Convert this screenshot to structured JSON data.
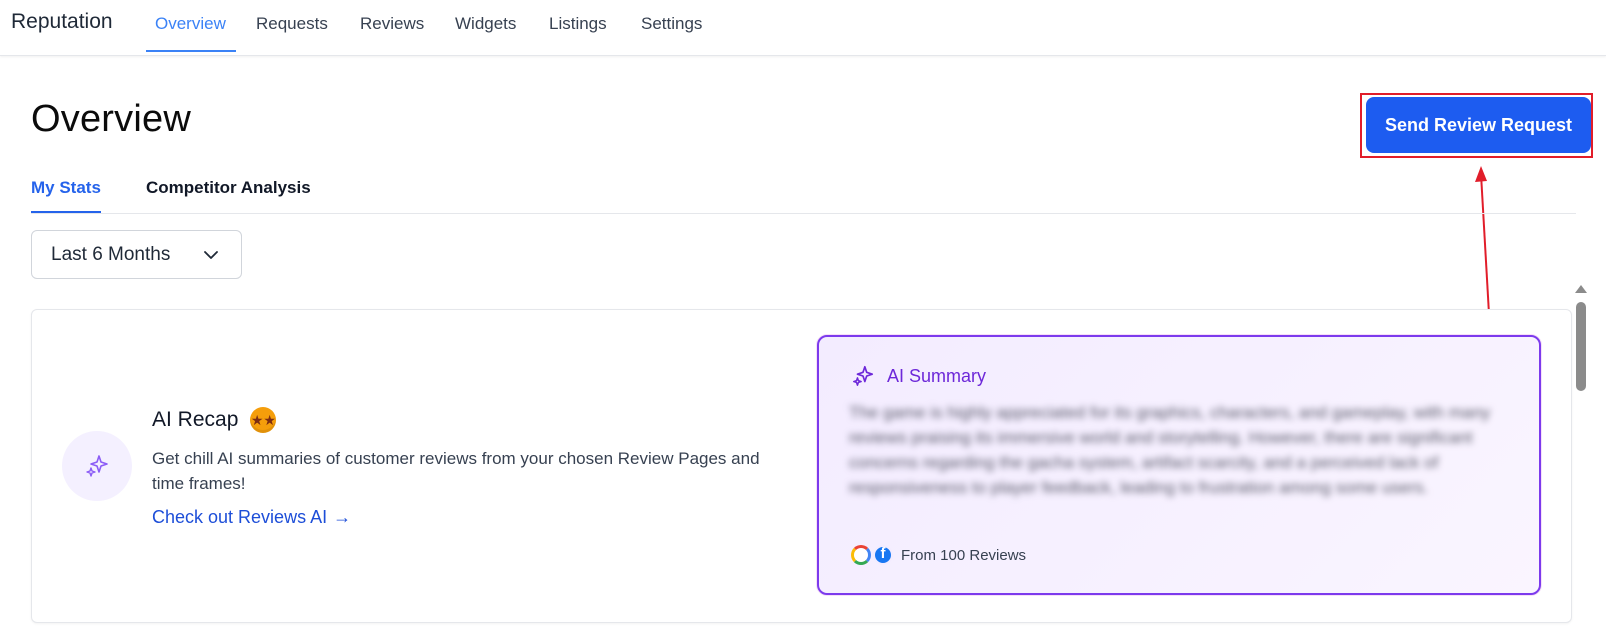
{
  "app": {
    "brand": "Reputation",
    "nav": [
      {
        "label": "Overview",
        "active": true
      },
      {
        "label": "Requests"
      },
      {
        "label": "Reviews"
      },
      {
        "label": "Widgets"
      },
      {
        "label": "Listings"
      },
      {
        "label": "Settings"
      }
    ]
  },
  "page": {
    "title": "Overview",
    "cta_label": "Send Review Request"
  },
  "subtabs": [
    {
      "label": "My Stats",
      "active": true
    },
    {
      "label": "Competitor Analysis"
    }
  ],
  "filter": {
    "selected": "Last 6 Months"
  },
  "recap": {
    "title": "AI Recap",
    "emoji_icon": "star-struck-emoji-icon",
    "description": "Get chill AI summaries of customer reviews from your chosen Review Pages and time frames!",
    "link_label": "Check out Reviews AI",
    "link_arrow": "→"
  },
  "summary": {
    "title": "AI Summary",
    "text": "The game is highly appreciated for its graphics, characters, and gameplay, with many reviews praising its immersive world and storytelling. However, there are significant concerns regarding the gacha system, artifact scarcity, and a perceived lack of responsiveness to player feedback, leading to frustration among some users.",
    "source_label": "From 100 Reviews",
    "sources": [
      "google-logo-icon",
      "facebook-logo-icon"
    ]
  },
  "colors": {
    "accent": "#1d5cf0",
    "nav_active": "#3b82f6",
    "highlight": "#e11d2a",
    "ai_purple": "#7c3aed"
  }
}
